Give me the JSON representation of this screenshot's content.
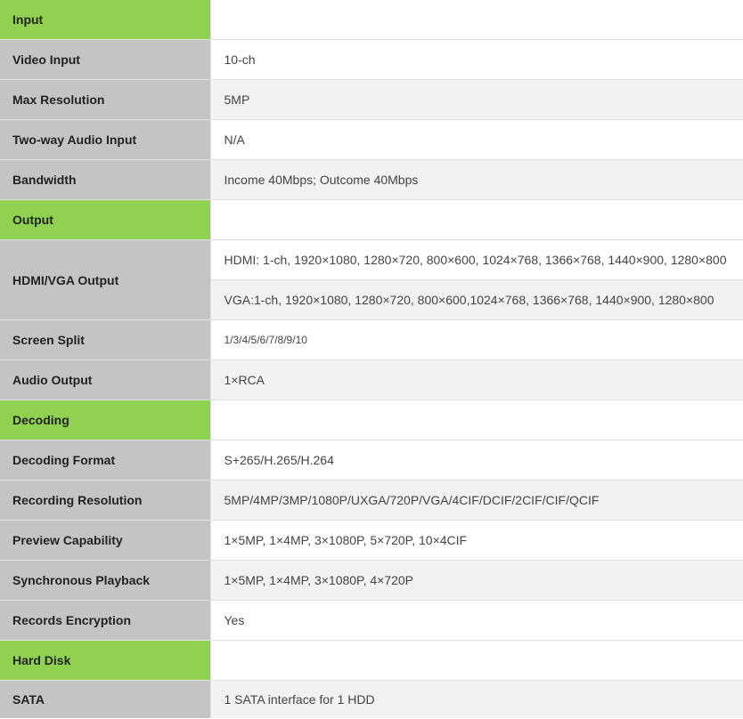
{
  "spec_table": {
    "sections": {
      "input": "Input",
      "output": "Output",
      "decoding": "Decoding",
      "hard_disk": "Hard Disk"
    },
    "rows": {
      "video_input": {
        "label": "Video Input",
        "value": "10-ch"
      },
      "max_resolution": {
        "label": "Max Resolution",
        "value": "5MP"
      },
      "two_way_audio": {
        "label": "Two-way Audio Input",
        "value": "N/A"
      },
      "bandwidth": {
        "label": "Bandwidth",
        "value": "Income 40Mbps; Outcome 40Mbps"
      },
      "hdmi_vga_output": {
        "label": "HDMI/VGA Output",
        "hdmi": "HDMI: 1-ch, 1920×1080, 1280×720, 800×600, 1024×768, 1366×768, 1440×900, 1280×800",
        "vga": "VGA:1-ch, 1920×1080, 1280×720, 800×600,1024×768, 1366×768, 1440×900, 1280×800"
      },
      "screen_split": {
        "label": "Screen Split",
        "value": "1/3/4/5/6/7/8/9/10"
      },
      "audio_output": {
        "label": "Audio Output",
        "value": "1×RCA"
      },
      "decoding_format": {
        "label": "Decoding Format",
        "value": "S+265/H.265/H.264"
      },
      "recording_resolution": {
        "label": "Recording Resolution",
        "value": "5MP/4MP/3MP/1080P/UXGA/720P/VGA/4CIF/DCIF/2CIF/CIF/QCIF"
      },
      "preview_capability": {
        "label": "Preview Capability",
        "value": "1×5MP, 1×4MP, 3×1080P, 5×720P, 10×4CIF"
      },
      "synchronous_playback": {
        "label": "Synchronous Playback",
        "value": "1×5MP, 1×4MP, 3×1080P, 4×720P"
      },
      "records_encryption": {
        "label": "Records Encryption",
        "value": "Yes"
      },
      "sata": {
        "label": "SATA",
        "value": "1 SATA interface for 1 HDD"
      }
    }
  },
  "colors": {
    "section_green": "#8fd150",
    "label_gray": "#c4c4c4",
    "row_alt": "#f2f2f2"
  }
}
